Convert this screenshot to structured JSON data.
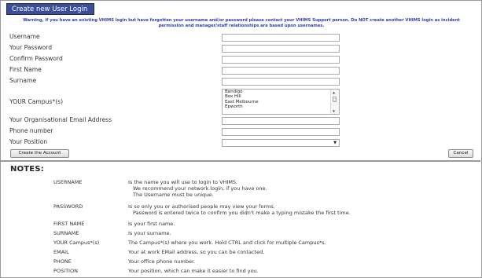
{
  "header": {
    "title": "Create new User Login",
    "warning_line1": "Warning, if you have an existing VHIMS login but have forgotten your username and/or password please contact your VHIMS Support person. Do NOT create another VHIMS login as incident",
    "warning_line2": "permission and manager/staff relationships are based upon usernames."
  },
  "form": {
    "username_label": "Username",
    "password_label": "Your Password",
    "confirm_label": "Confirm Password",
    "firstname_label": "First Name",
    "surname_label": "Surname",
    "campus_label": "YOUR Campus*(s)",
    "campus_options": [
      "Bendigo",
      "Box Hill",
      "East Melbourne",
      "Epworth"
    ],
    "email_label": "Your Organisational Email Address",
    "phone_label": "Phone number",
    "position_label": "Your Position",
    "position_value": ""
  },
  "buttons": {
    "create": "Create the Account",
    "cancel": "Cancel"
  },
  "notes": {
    "title": "NOTES:",
    "items": [
      {
        "term": "USERNAME",
        "lines": [
          "Is the name you will use to login to VHIMS.",
          "We recommend your network login, if you have one.",
          "The Username must be unique."
        ]
      },
      {
        "term": "PASSWORD",
        "lines": [
          "Is so only you or authorised people may view your forms.",
          "Password is entered twice to confirm you didn't make a typing mistake the first time."
        ]
      },
      {
        "term": "FIRST NAME",
        "lines": [
          "Is your first name."
        ]
      },
      {
        "term": "SURNAME",
        "lines": [
          "Is your surname."
        ]
      },
      {
        "term": "YOUR Campus*(s)",
        "lines": [
          "The Campus*(s) where you work. Hold CTRL and click for multiple Campus*s."
        ]
      },
      {
        "term": "EMAIL",
        "lines": [
          "Your at work EMail address, so you can be contacted."
        ]
      },
      {
        "term": "PHONE",
        "lines": [
          "Your office phone number."
        ]
      },
      {
        "term": "POSITION",
        "lines": [
          "Your position, which can make it easier to find you."
        ]
      }
    ]
  }
}
